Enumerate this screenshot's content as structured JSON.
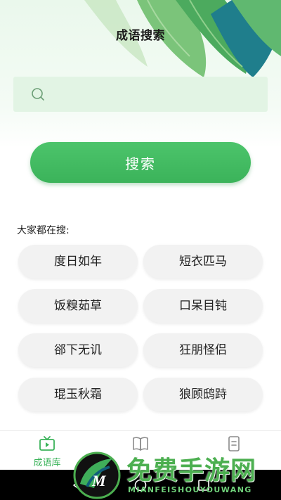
{
  "header": {
    "title": "成语搜索"
  },
  "search": {
    "placeholder": "",
    "value": "",
    "button_label": "搜索"
  },
  "hot": {
    "label": "大家都在搜:",
    "items": [
      "度日如年",
      "短衣匹马",
      "饭糗茹草",
      "口呆目钝",
      "郤下无讥",
      "狂朋怪侣",
      "琨玉秋霜",
      "狼顾鸱跱"
    ]
  },
  "tabbar": {
    "tabs": [
      {
        "label": "成语库",
        "icon": "tv-icon",
        "active": true
      },
      {
        "label": "",
        "icon": "book-icon",
        "active": false
      },
      {
        "label": "",
        "icon": "note-icon",
        "active": false
      }
    ]
  },
  "watermark": {
    "text": "免费手游网",
    "subtext": "MIANFEISHOUYOUWANG"
  },
  "colors": {
    "accent": "#3bb35a",
    "chip_bg": "#f2f2f2",
    "search_bg": "#e2f4e4"
  }
}
